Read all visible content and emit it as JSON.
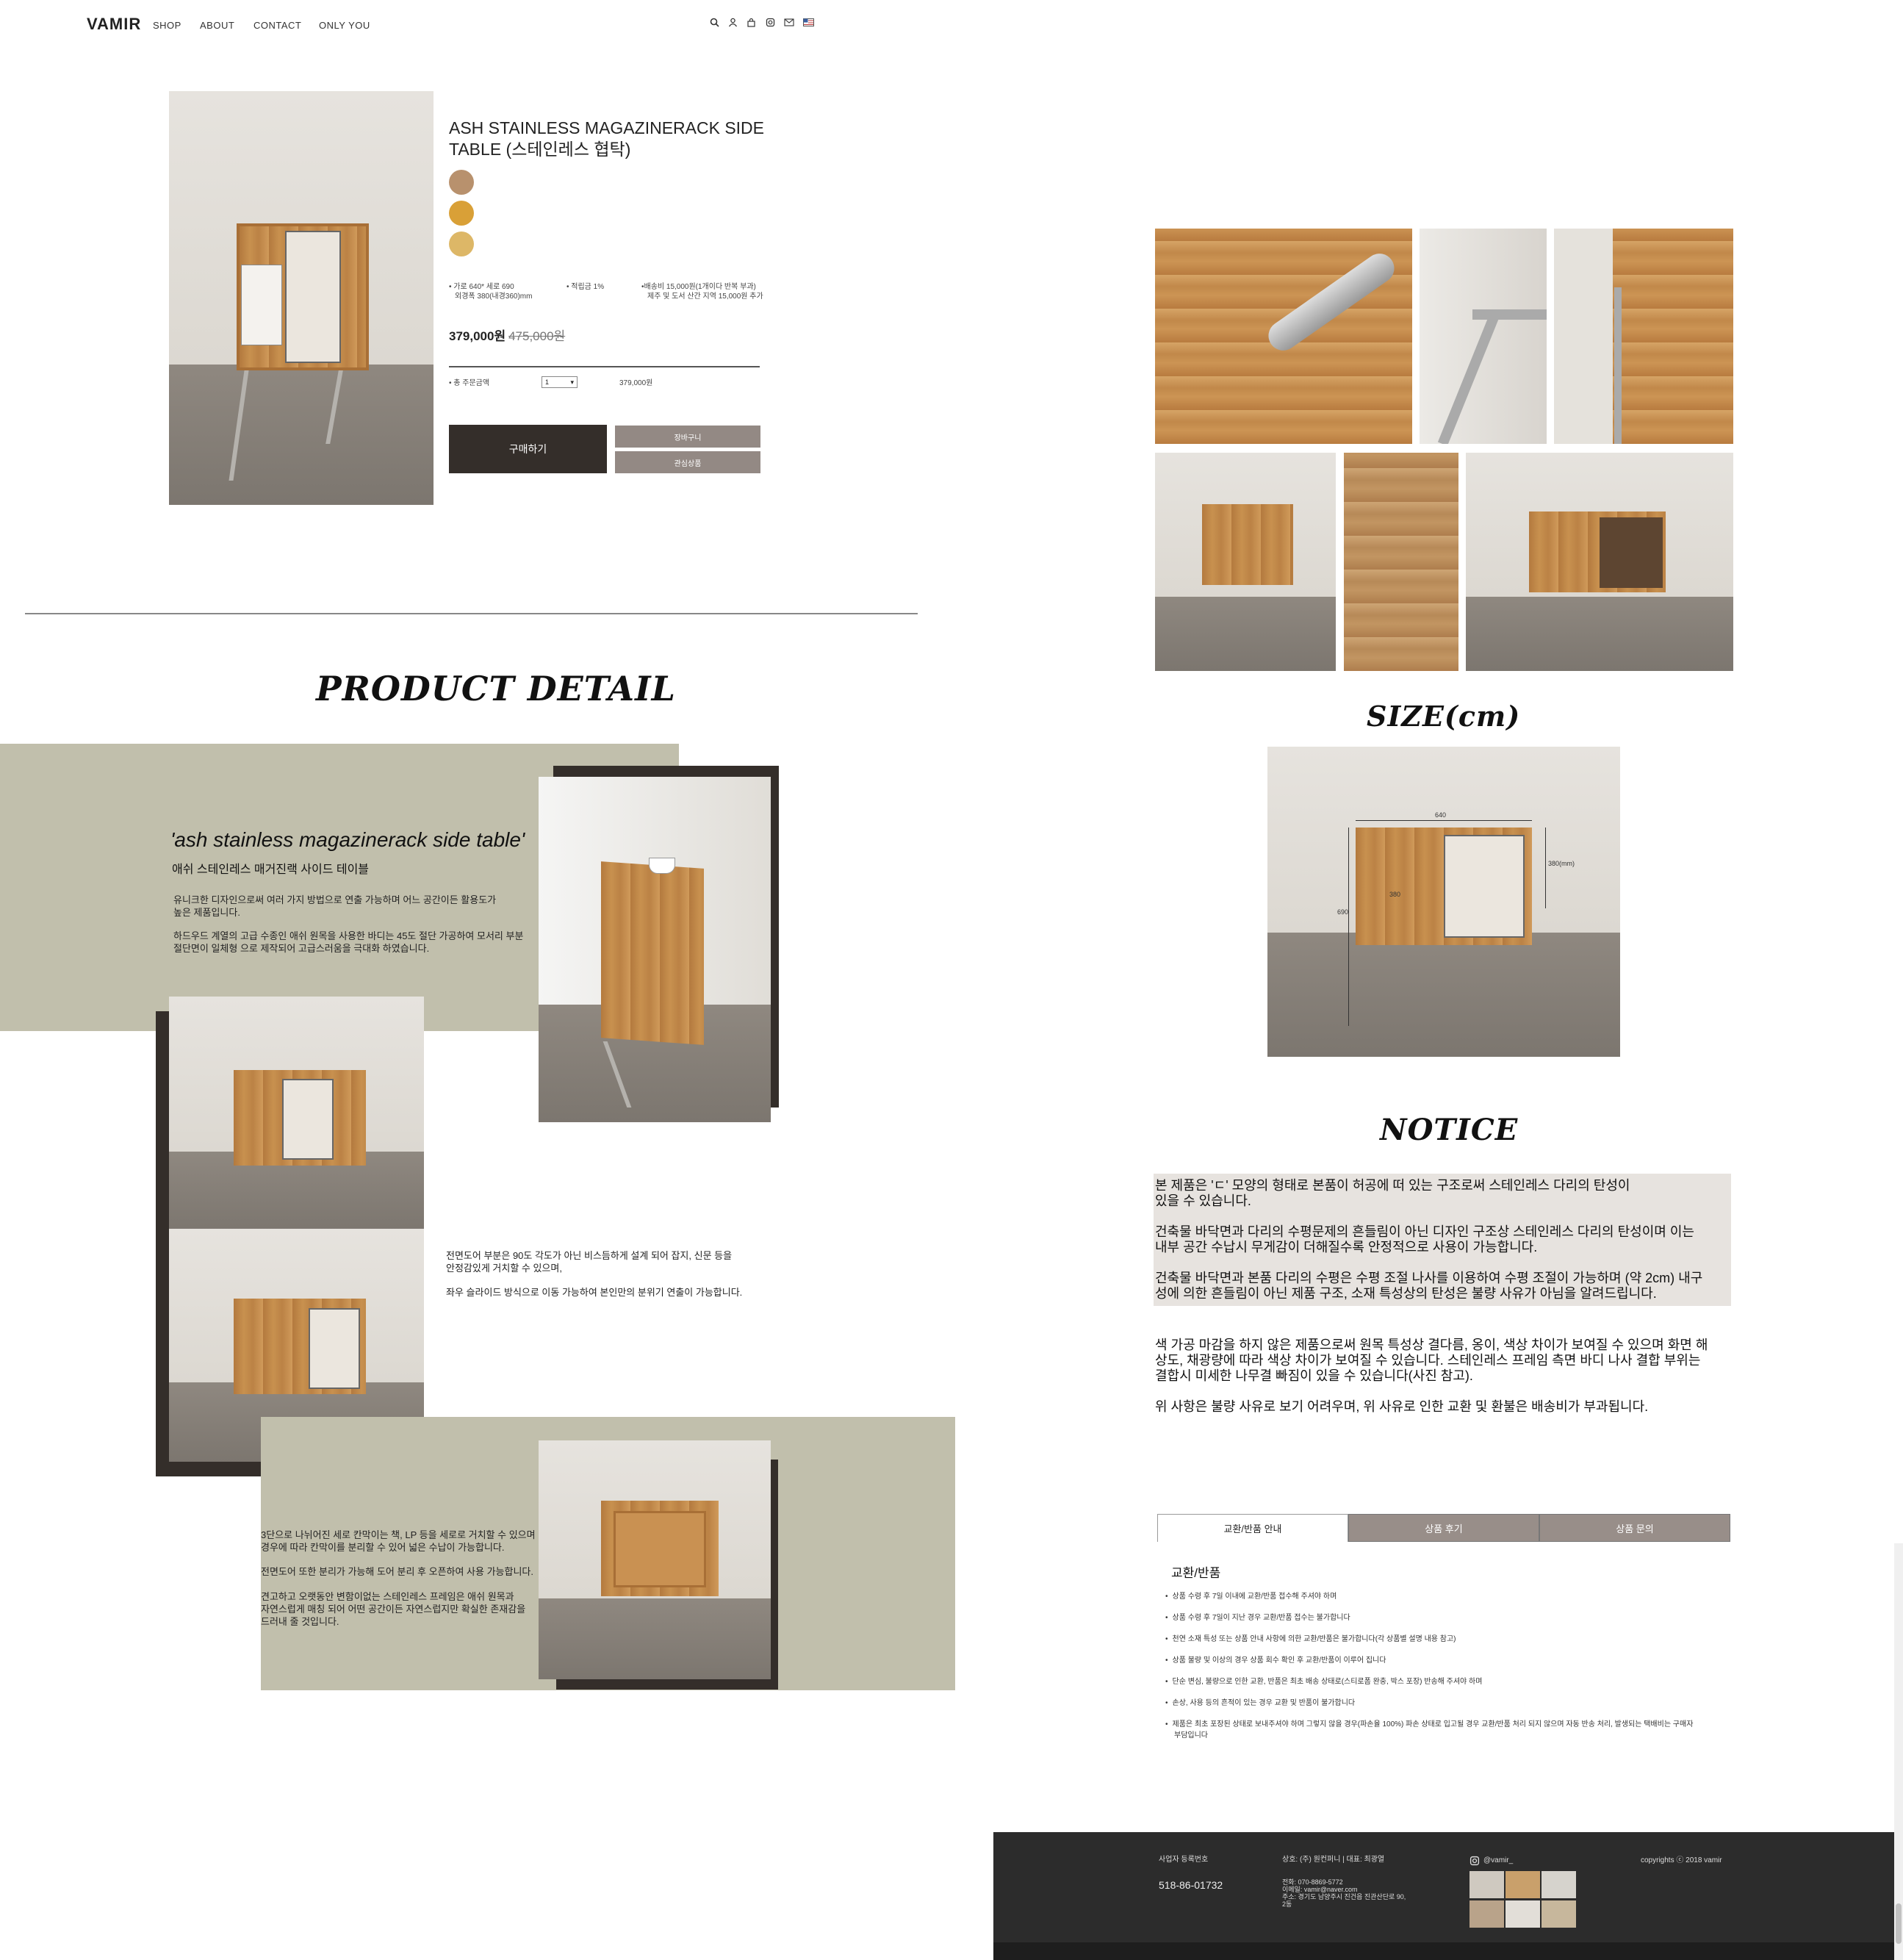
{
  "header": {
    "logo": "VAMIR",
    "nav": [
      "SHOP",
      "ABOUT",
      "CONTACT",
      "ONLY YOU"
    ],
    "icons": [
      "search-icon",
      "user-icon",
      "bag-icon",
      "instagram-icon",
      "mail-icon",
      "flag-icon"
    ]
  },
  "product": {
    "title": "ASH STAINLESS MAGAZINERACK SIDE TABLE (스테인레스 협탁)",
    "swatches": [
      "#b8916d",
      "#d9a037",
      "#ddb767"
    ],
    "spec_size": "• 가로 640* 세로 690",
    "spec_size2": "외경폭 380(내경360)mm",
    "spec_points": "• 적립금 1%",
    "spec_ship": "•배송비 15,000원(1개이다 반복 부과)",
    "spec_ship2": "제주 및 도서 산간 지역 15,000원 추가",
    "price": "379,000원",
    "old_price": "475,000원",
    "total_label": "• 총 주문금액",
    "quantity": "1",
    "total": "379,000원",
    "buy_label": "구매하기",
    "cart_label": "장바구니",
    "wish_label": "관심상품"
  },
  "detail": {
    "heading": "PRODUCT DETAIL",
    "name_en": "'ash stainless magazinerack side table'",
    "name_ko": "애쉬 스테인레스 매거진랙 사이드 테이블",
    "p1a": "유니크한 디자인으로써 여러 가지 방법으로 연출 가능하며 어느 공간이든 활용도가",
    "p1b": "높은 제품입니다.",
    "p2a": "하드우드 계열의 고급 수종인 애쉬 원목을 사용한 바디는 45도 절단 가공하여 모서리 부분",
    "p2b": "절단면이 일체형 으로 제작되어 고급스러움을 극대화 하였습니다.",
    "p3a": "전면도어 부분은 90도 각도가 아닌 비스듬하게 설계 되어 잡지, 신문 등을",
    "p3b": "안정감있게 거치할 수 있으며,",
    "p4": "좌우 슬라이드 방식으로 이동 가능하여 본인만의 분위기 연출이 가능합니다.",
    "p5a": "3단으로 나뉘어진 세로 칸막이는 책, LP 등을 세로로 거치할 수 있으며",
    "p5b": "경우에 따라 칸막이를 분리할 수 있어 넓은 수납이 가능합니다.",
    "p6": "전면도어 또한 분리가 가능해 도어 분리 후 오픈하여 사용 가능합니다.",
    "p7a": "견고하고 오랫동안 변함이없는 스테인레스 프레임은 애쉬 원목과",
    "p7b": "자연스럽게 매칭 되어 어떤 공간이든 자연스럽지만 확실한 존재감을",
    "p7c": "드러내 줄 것입니다."
  },
  "size": {
    "heading": "SIZE(cm)",
    "width": "640",
    "height": "690",
    "depth": "380",
    "inner": "380(mm)"
  },
  "notice": {
    "heading": "NOTICE",
    "p1a": "본 제품은 'ㄷ' 모양의 형태로 본품이 허공에 떠 있는 구조로써 스테인레스 다리의 탄성이",
    "p1b": "있을 수 있습니다.",
    "p2a": "건축물 바닥면과 다리의 수평문제의 흔들림이 아닌 디자인 구조상 스테인레스 다리의 탄성이며 이는",
    "p2b": "내부 공간 수납시 무게감이 더해질수록 안정적으로 사용이 가능합니다.",
    "p3a": "건축물 바닥면과 본품 다리의 수평은 수평 조절 나사를 이용하여 수평 조절이 가능하며 (약 2cm) 내구",
    "p3b": "성에 의한 흔들림이 아닌 제품 구조, 소재 특성상의 탄성은 불량 사유가 아님을 알려드립니다.",
    "p4a": "색 가공 마감을 하지 않은 제품으로써 원목 특성상 결다름, 옹이, 색상 차이가 보여질 수 있으며 화면 해",
    "p4b": "상도, 채광량에 따라 색상 차이가 보여질 수 있습니다. 스테인레스 프레임 측면 바디 나사 결합 부위는",
    "p4c": "결합시 미세한 나무결 빠짐이 있을 수 있습니다(사진 참고).",
    "p5": "위 사항은 불량 사유로 보기 어려우며, 위 사유로 인한 교환 및 환불은 배송비가 부과됩니다."
  },
  "tabs": [
    "교환/반품 안내",
    "상품 후기",
    "상품 문의"
  ],
  "exchange": {
    "heading": "교환/반품",
    "rules": [
      "상품 수령 후 7일 이내에 교환/반품 접수해 주셔야 하며",
      "상품 수령 후 7일이 지난 경우 교환/반품 접수는 불가합니다",
      "천연 소재 특성 또는 상품 안내 사항에 의한 교환/반품은 불가합니다(각 상품별 설명 내용 참고)",
      "상품 불량 및 이상의 경우 상품 회수 확인 후 교환/반품이 이루어 집니다",
      "단순 변심, 불량으로 인한 교환, 반품은 최초 배송 상태로(스티로폼 완충, 박스 포장) 반송해 주셔야 하며",
      "손상, 사용 등의 흔적이 있는 경우 교환 및 반품이 불가합니다",
      "제품은 최초 포장된 상태로 보내주셔야 하며 그렇지 않을 경우(파손율 100%) 파손 상태로 입고될 경우 교환/반품 처리 되지 않으며 자동 반송 처리, 발생되는 택배비는 구매자"
    ],
    "rule_last_cont": "부담입니다"
  },
  "footer": {
    "reg_label": "사업자 등록번호",
    "reg_no": "518-86-01732",
    "company": "상호: (주) 원컨퍼니 | 대표: 최광열",
    "phone": "전화: 070-8869-5772",
    "email": "이메일: vamir@naver.com",
    "address": "주소: 경기도 남양주시 진건읍 진관산단로 90,",
    "address2": "2동",
    "insta": "@vamir_",
    "copyright": "copyrights ⓒ 2018 vamir"
  },
  "colors": {
    "accent_dark": "#342e2a",
    "button_grey": "#938984",
    "band_beige": "#c1bfac",
    "notice_bg": "#e7e3df",
    "footer_bg": "#2c2c2c"
  }
}
